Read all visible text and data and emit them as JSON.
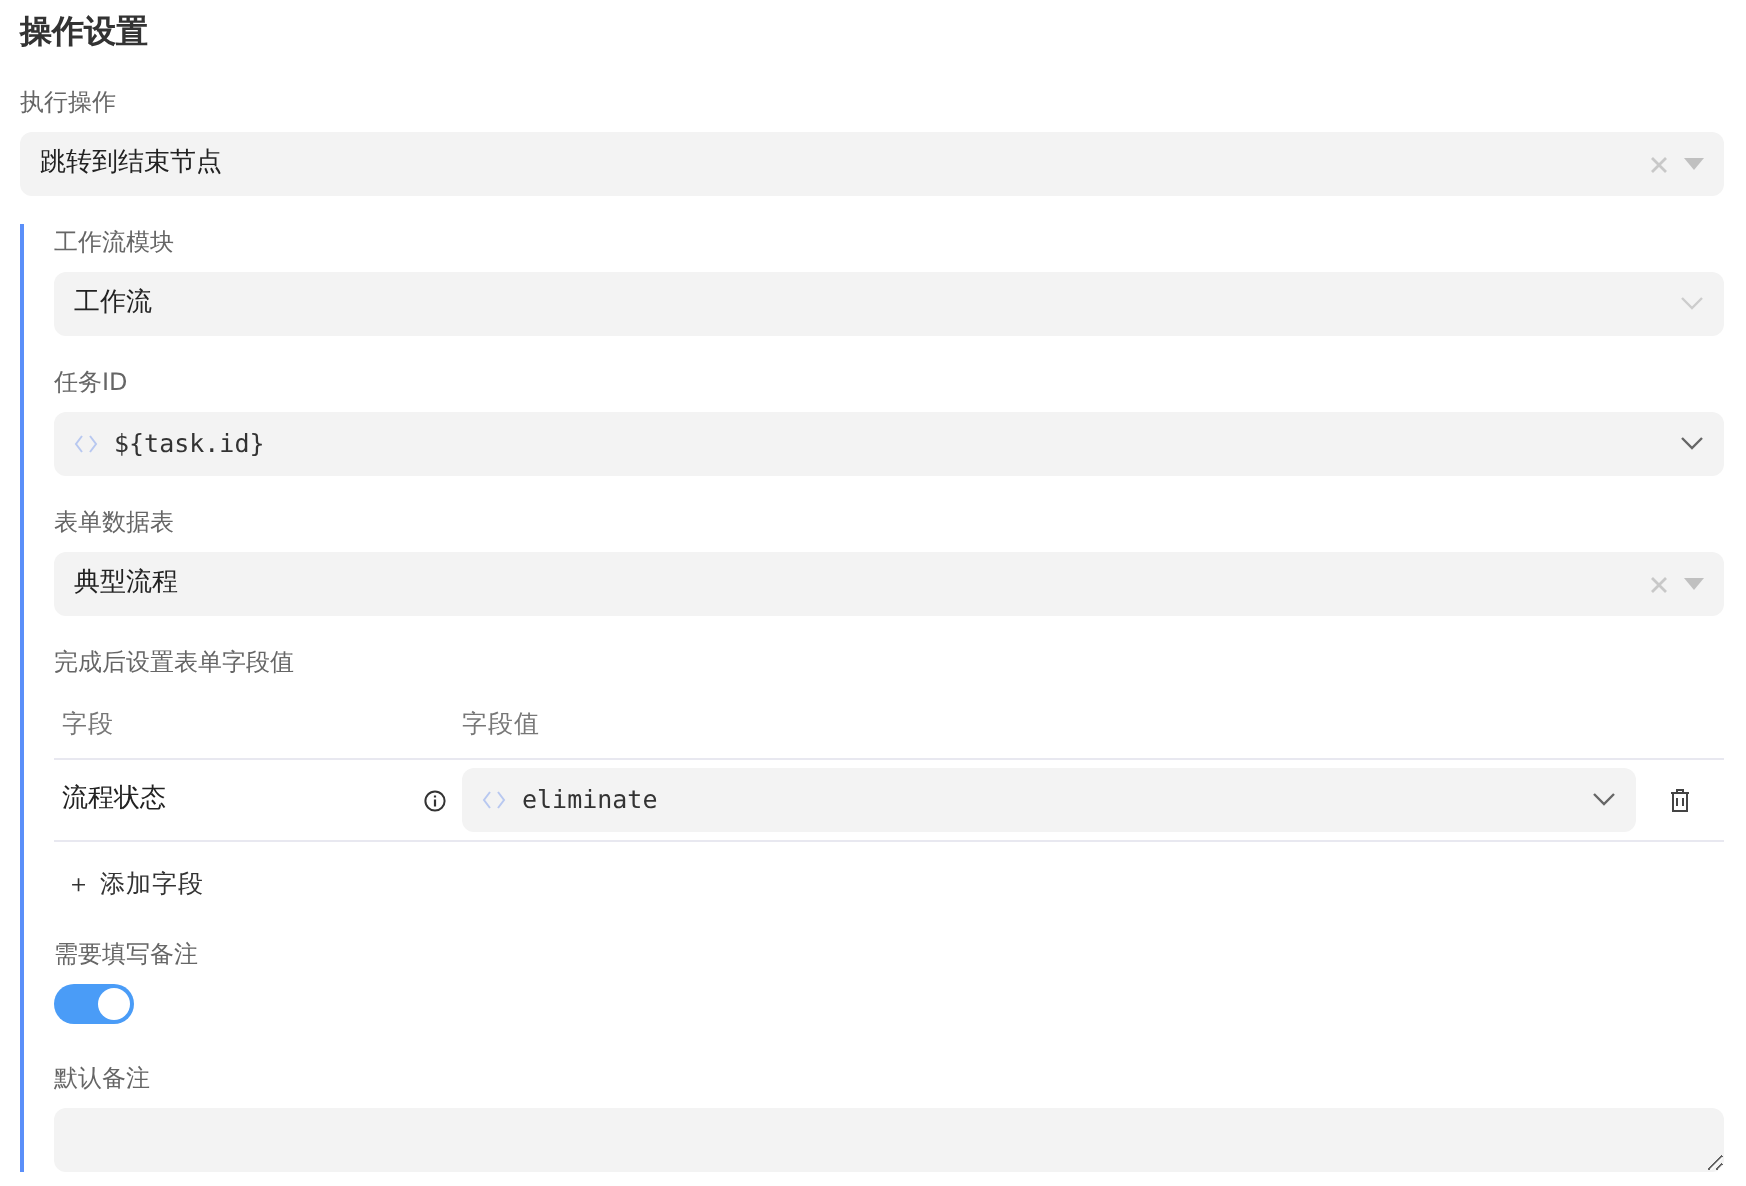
{
  "title": "操作设置",
  "action": {
    "label": "执行操作",
    "value": "跳转到结束节点",
    "kind": "clearable"
  },
  "fields": [
    {
      "label": "工作流模块",
      "value": "工作流",
      "kind": "chevron-light"
    },
    {
      "label": "任务ID",
      "value": "${task.id}",
      "kind": "expression"
    },
    {
      "label": "表单数据表",
      "value": "典型流程",
      "kind": "clearable"
    }
  ],
  "field_values": {
    "label": "完成后设置表单字段值",
    "columns": [
      "字段",
      "字段值"
    ],
    "rows": [
      {
        "field": "流程状态",
        "value": "eliminate"
      }
    ],
    "add_button": "＋ 添加字段"
  },
  "remark_required": {
    "label": "需要填写备注",
    "on": true
  },
  "default_remark": {
    "label": "默认备注"
  }
}
